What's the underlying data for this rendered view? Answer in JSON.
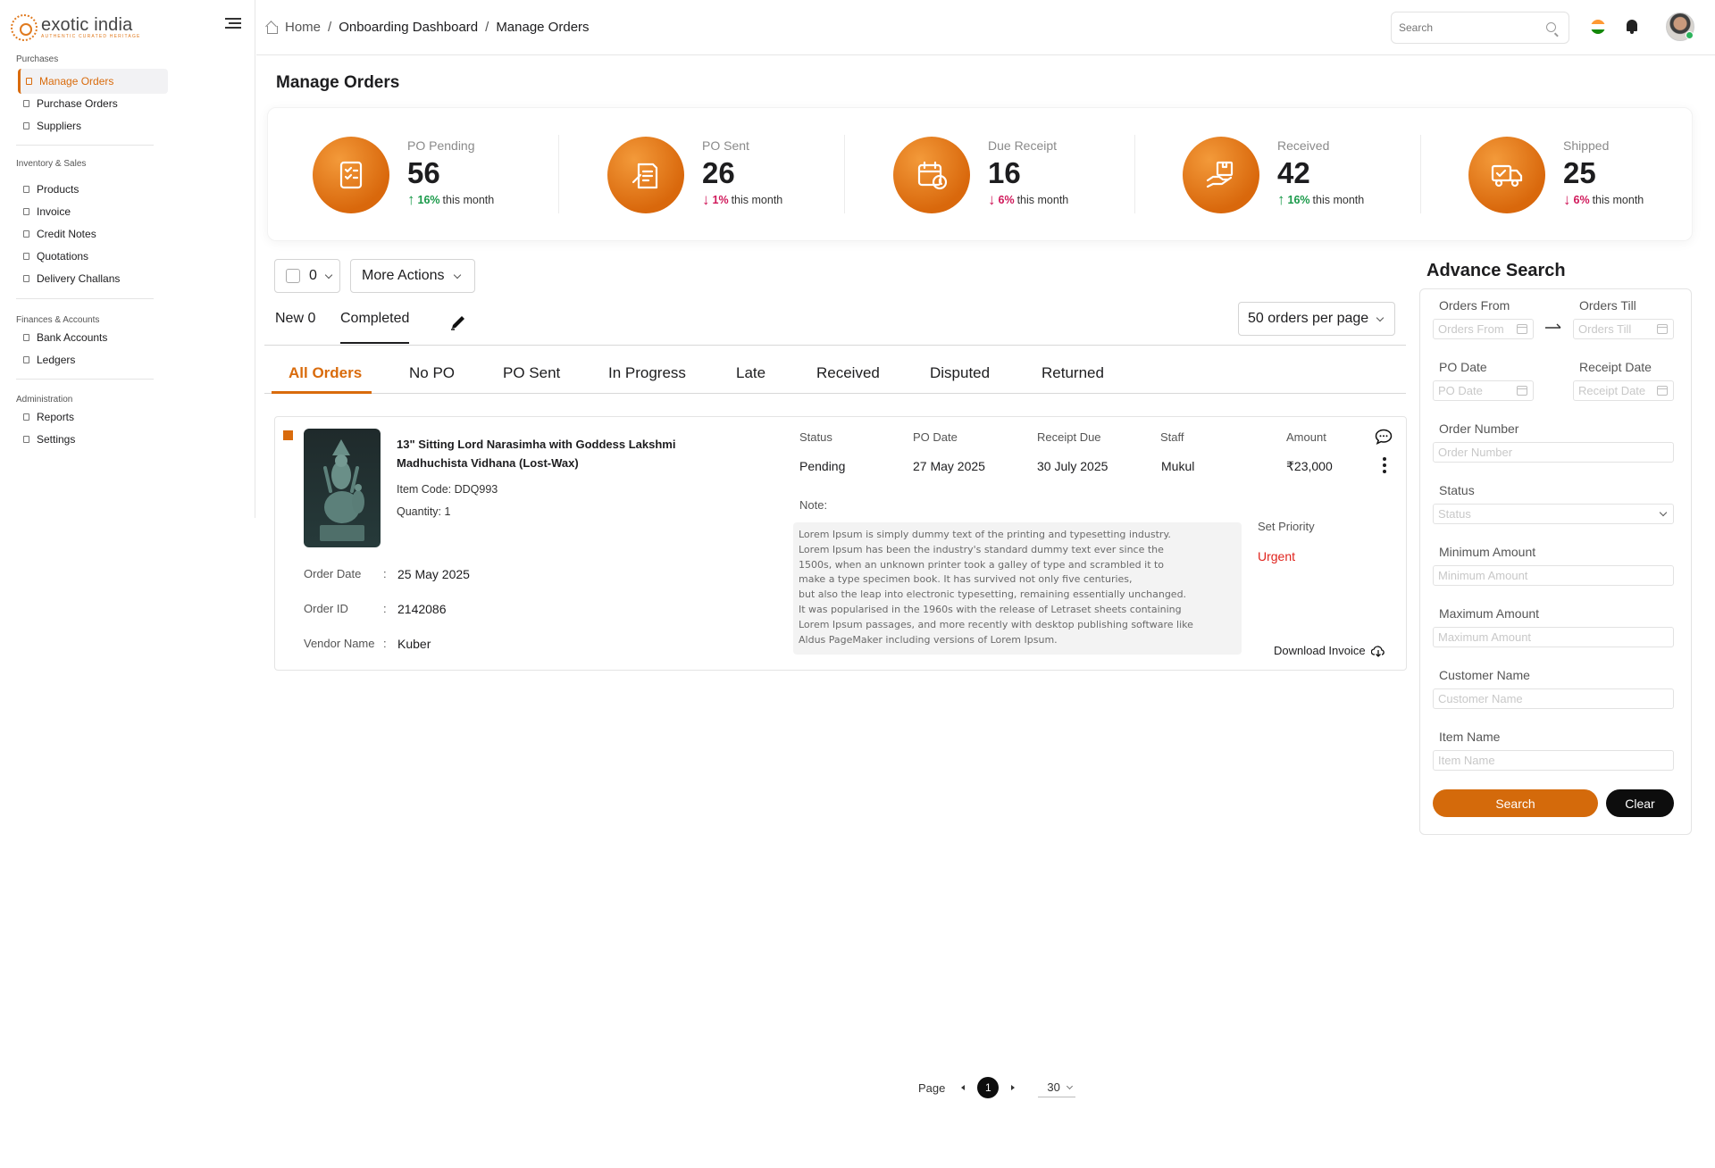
{
  "brand": {
    "name": "exotic india",
    "tagline": "AUTHENTIC CURATED HERITAGE"
  },
  "sidebar": {
    "sections": [
      {
        "title": "Purchases",
        "items": [
          {
            "label": "Manage Orders",
            "active": true
          },
          {
            "label": "Purchase Orders"
          },
          {
            "label": "Suppliers"
          }
        ]
      },
      {
        "title": "Inventory & Sales",
        "items": [
          {
            "label": "Products"
          },
          {
            "label": "Invoice"
          },
          {
            "label": "Credit Notes"
          },
          {
            "label": "Quotations"
          },
          {
            "label": "Delivery Challans"
          }
        ]
      },
      {
        "title": "Finances & Accounts",
        "items": [
          {
            "label": "Bank Accounts"
          },
          {
            "label": "Ledgers"
          }
        ]
      },
      {
        "title": "Administration",
        "items": [
          {
            "label": "Reports"
          },
          {
            "label": "Settings"
          }
        ]
      }
    ]
  },
  "header": {
    "breadcrumb": [
      "Home",
      "Onboarding Dashboard",
      "Manage Orders"
    ],
    "separator": "/",
    "search_placeholder": "Search"
  },
  "page": {
    "title": "Manage Orders"
  },
  "stats": [
    {
      "label": "PO Pending",
      "value": "56",
      "trend": "up",
      "pct": "16%",
      "suffix": "this month"
    },
    {
      "label": "PO Sent",
      "value": "26",
      "trend": "down",
      "pct": "1%",
      "suffix": "this month"
    },
    {
      "label": "Due Receipt",
      "value": "16",
      "trend": "down",
      "pct": "6%",
      "suffix": "this month"
    },
    {
      "label": "Received",
      "value": "42",
      "trend": "up",
      "pct": "16%",
      "suffix": "this month"
    },
    {
      "label": "Shipped",
      "value": "25",
      "trend": "down",
      "pct": "6%",
      "suffix": "this month"
    }
  ],
  "toolbar": {
    "selected_count": "0",
    "more_actions": "More Actions",
    "tabs": [
      "New 0",
      "Completed"
    ],
    "per_page": "50 orders per page"
  },
  "status_tabs": [
    "All Orders",
    "No PO",
    "PO Sent",
    "In Progress",
    "Late",
    "Received",
    "Disputed",
    "Returned"
  ],
  "order": {
    "title": "13\" Sitting Lord Narasimha with Goddess Lakshmi Madhuchista Vidhana (Lost-Wax)",
    "item_code": "Item Code: DDQ993",
    "quantity": "Quantity: 1",
    "order_date_label": "Order Date",
    "order_date": "25 May 2025",
    "order_id_label": "Order ID",
    "order_id": "2142086",
    "vendor_label": "Vendor Name",
    "vendor": "Kuber",
    "colon": ":",
    "columns": {
      "status_label": "Status",
      "status": "Pending",
      "po_date_label": "PO Date",
      "po_date": "27 May 2025",
      "receipt_due_label": "Receipt Due",
      "receipt_due": "30 July 2025",
      "staff_label": "Staff",
      "staff": "Mukul",
      "amount_label": "Amount",
      "amount": "₹23,000"
    },
    "note_label": "Note:",
    "note": "Lorem Ipsum is simply dummy text of the printing and  typesetting industry.\nLorem Ipsum has been the industry's standard dummy text ever since the\n1500s, when an unknown printer took a galley of  type and scrambled it to\nmake a type specimen book. It has survived not  only five centuries,\nbut also the leap into electronic typesetting,  remaining essentially unchanged.\nIt was popularised in the 1960s with  the release of Letraset sheets containing\nLorem Ipsum passages, and more recently with desktop publishing software like\nAldus PageMaker  including versions of Lorem Ipsum.",
    "priority_label": "Set Priority",
    "priority": "Urgent",
    "download": "Download Invoice"
  },
  "advance_search": {
    "title": "Advance Search",
    "orders_from_label": "Orders From",
    "orders_from_placeholder": "Orders From",
    "orders_till_label": "Orders Till",
    "orders_till_placeholder": "Orders Till",
    "po_date_label": "PO Date",
    "po_date_placeholder": "PO Date",
    "receipt_date_label": "Receipt Date",
    "receipt_date_placeholder": "Receipt Date",
    "order_number_label": "Order Number",
    "order_number_placeholder": "Order Number",
    "status_label": "Status",
    "status_placeholder": "Status",
    "min_amount_label": "Minimum Amount",
    "min_amount_placeholder": "Minimum Amount",
    "max_amount_label": "Maximum Amount",
    "max_amount_placeholder": "Maximum Amount",
    "customer_name_label": "Customer Name",
    "customer_name_placeholder": "Customer Name",
    "item_name_label": "Item Name",
    "item_name_placeholder": "Item Name",
    "search_button": "Search",
    "clear_button": "Clear"
  },
  "pagination": {
    "label": "Page",
    "current": "1",
    "page_size": "30"
  },
  "colors": {
    "accent": "#d96b0c",
    "up": "#1a9a4a",
    "down": "#d0185a",
    "urgent": "#e0221c"
  }
}
